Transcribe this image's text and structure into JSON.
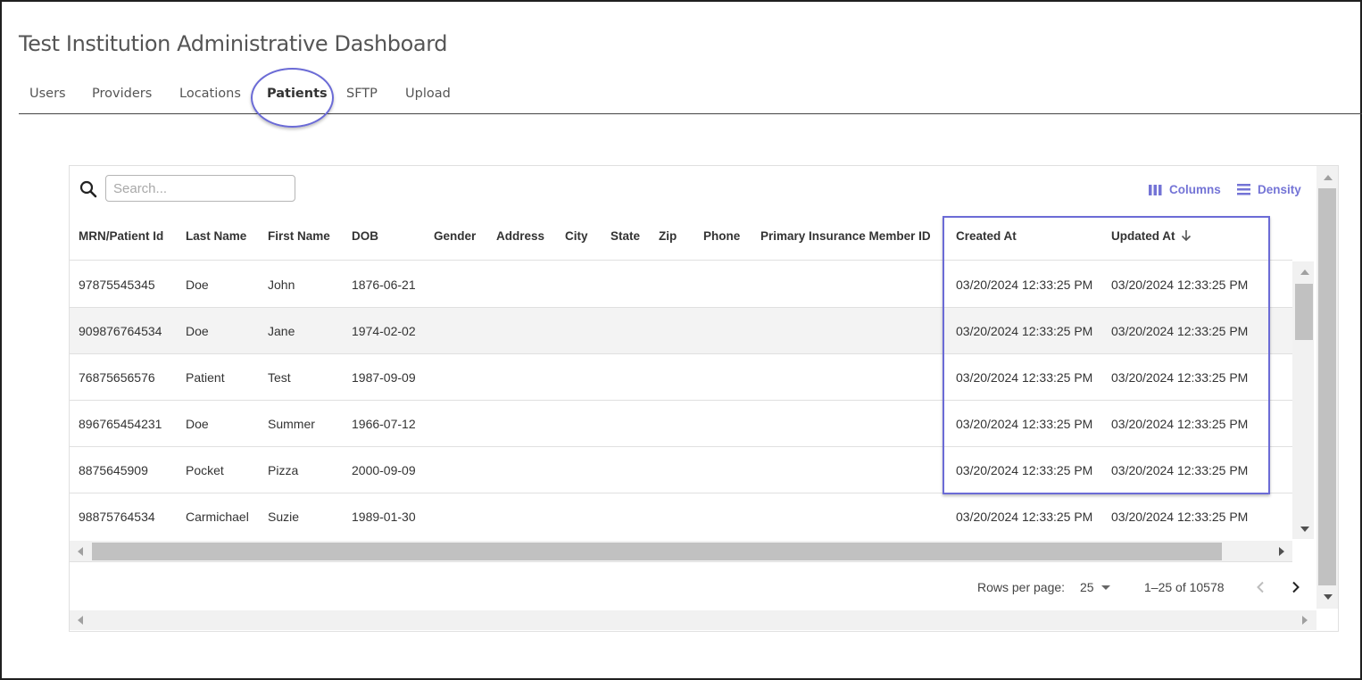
{
  "page": {
    "title": "Test Institution Administrative Dashboard"
  },
  "tabs": [
    {
      "label": "Users",
      "active": false
    },
    {
      "label": "Providers",
      "active": false
    },
    {
      "label": "Locations",
      "active": false
    },
    {
      "label": "Patients",
      "active": true
    },
    {
      "label": "SFTP",
      "active": false
    },
    {
      "label": "Upload",
      "active": false
    }
  ],
  "toolbar": {
    "search_placeholder": "Search...",
    "columns_label": "Columns",
    "density_label": "Density",
    "accent_color": "#7474d6"
  },
  "table": {
    "columns": [
      "MRN/Patient Id",
      "Last Name",
      "First Name",
      "DOB",
      "Gender",
      "Address",
      "City",
      "State",
      "Zip",
      "Phone",
      "Primary Insurance Member ID",
      "Created At",
      "Updated At"
    ],
    "sort": {
      "column": "Updated At",
      "direction": "descending"
    },
    "rows": [
      {
        "mrn": "97875545345",
        "last": "Doe",
        "first": "John",
        "dob": "1876-06-21",
        "created": "03/20/2024 12:33:25 PM",
        "updated": "03/20/2024 12:33:25 PM"
      },
      {
        "mrn": "909876764534",
        "last": "Doe",
        "first": "Jane",
        "dob": "1974-02-02",
        "created": "03/20/2024 12:33:25 PM",
        "updated": "03/20/2024 12:33:25 PM"
      },
      {
        "mrn": "76875656576",
        "last": "Patient",
        "first": "Test",
        "dob": "1987-09-09",
        "created": "03/20/2024 12:33:25 PM",
        "updated": "03/20/2024 12:33:25 PM"
      },
      {
        "mrn": "896765454231",
        "last": "Doe",
        "first": "Summer",
        "dob": "1966-07-12",
        "created": "03/20/2024 12:33:25 PM",
        "updated": "03/20/2024 12:33:25 PM"
      },
      {
        "mrn": "8875645909",
        "last": "Pocket",
        "first": "Pizza",
        "dob": "2000-09-09",
        "created": "03/20/2024 12:33:25 PM",
        "updated": "03/20/2024 12:33:25 PM"
      },
      {
        "mrn": "98875764534",
        "last": "Carmichael",
        "first": "Suzie",
        "dob": "1989-01-30",
        "created": "03/20/2024 12:33:25 PM",
        "updated": "03/20/2024 12:33:25 PM"
      }
    ]
  },
  "pagination": {
    "rows_per_page_label": "Rows per page:",
    "rows_per_page": "25",
    "range": "1–25 of 10578"
  },
  "annotation_color": "#6b6bd6"
}
